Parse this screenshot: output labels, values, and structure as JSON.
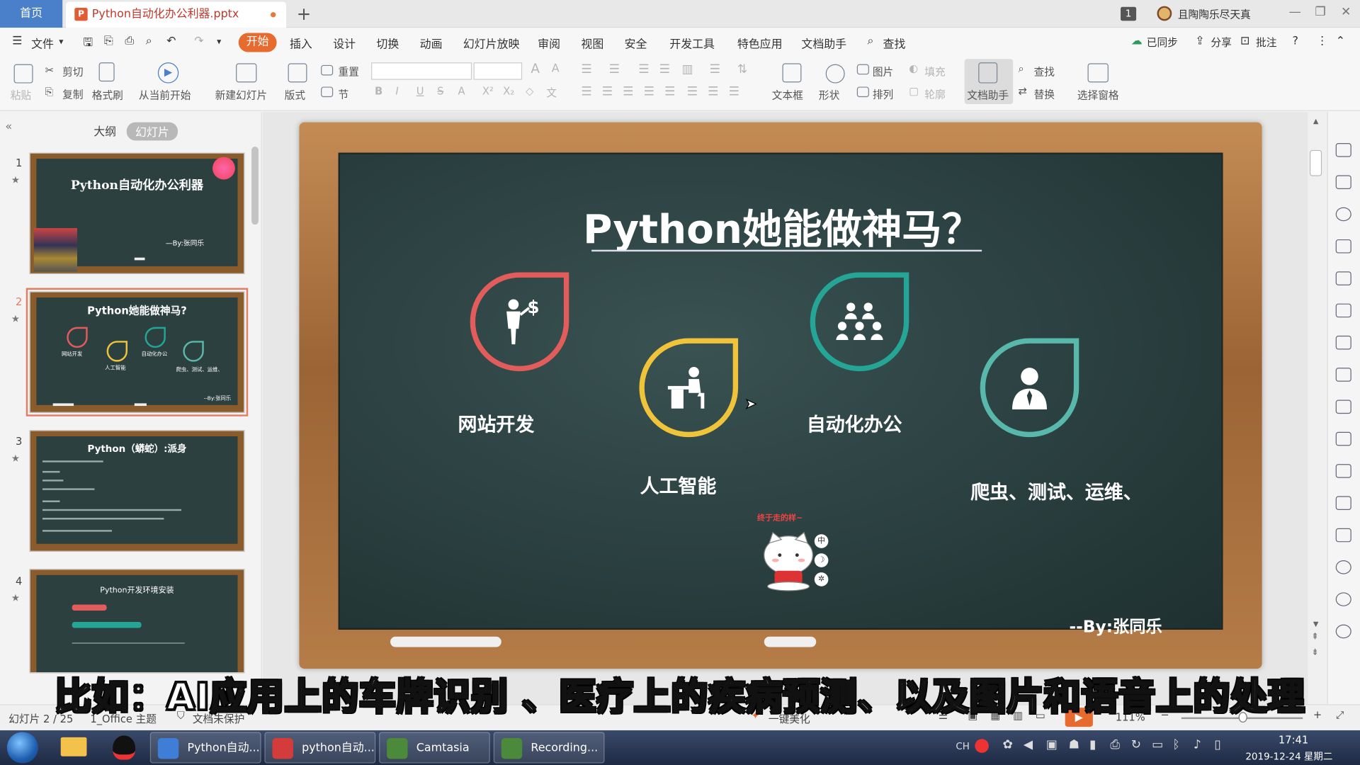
{
  "tabs": {
    "home": "首页",
    "doc": "Python自动化办公利器.pptx",
    "new_tab": "+"
  },
  "titlebar": {
    "badge": "1",
    "user": "且陶陶乐尽天真"
  },
  "menu": {
    "file": "文件",
    "items": [
      "插入",
      "设计",
      "切换",
      "动画",
      "幻灯片放映",
      "审阅",
      "视图",
      "安全",
      "开发工具",
      "特色应用",
      "文档助手"
    ],
    "active": "开始",
    "search": "查找",
    "sync": "已同步",
    "share": "分享",
    "review": "批注"
  },
  "ribbon": {
    "paste": "粘贴",
    "cut": "剪切",
    "copy": "复制",
    "format_painter": "格式刷",
    "from_current": "从当前开始",
    "new_slide": "新建幻灯片",
    "layout": "版式",
    "reset": "重置",
    "section": "节",
    "textbox": "文本框",
    "shape": "形状",
    "picture": "图片",
    "arrange": "排列",
    "fill": "填充",
    "outline": "轮廓",
    "doc_assistant": "文档助手",
    "find": "查找",
    "replace": "替换",
    "select_pane": "选择窗格"
  },
  "left_panel": {
    "tab_outline": "大纲",
    "tab_slides": "幻灯片"
  },
  "thumbnails": [
    {
      "num": "1",
      "title": "Python自动化办公利器",
      "by": "—By:张同乐"
    },
    {
      "num": "2",
      "title": "Python她能做神马?",
      "labels": [
        "网站开发",
        "人工智能",
        "自动化办公",
        "爬虫、测试、运维、"
      ],
      "by": "--By:张同乐"
    },
    {
      "num": "3",
      "title": "Python（蟒蛇）:派身"
    },
    {
      "num": "4",
      "title": "Python开发环境安装"
    }
  ],
  "slide": {
    "title": "Python她能做神马？",
    "items": [
      {
        "label": "网站开发",
        "icon": "presenter-dollar-icon",
        "color": "#e25c5c"
      },
      {
        "label": "人工智能",
        "icon": "desk-worker-icon",
        "color": "#f0c43a"
      },
      {
        "label": "自动化办公",
        "icon": "team-icon",
        "color": "#24a595"
      },
      {
        "label": "爬虫、测试、运维、",
        "icon": "person-icon",
        "color": "#58b8ab"
      }
    ],
    "byline": "--By:张同乐",
    "mascot_caption": "终于走的样~",
    "mascot_tools": [
      "中",
      "☽",
      "✲"
    ]
  },
  "subtitle": "比如：AI应用上的车牌识别 、医疗上的疾病预测、以及图片和语音上的处理",
  "statusbar": {
    "slide_info": "幻灯片 2 / 25",
    "theme": "1_Office 主题",
    "protection": "文档未保护",
    "beautify": "一键美化",
    "zoom": "111%"
  },
  "taskbar": {
    "apps": [
      {
        "label": "Python自动...",
        "color": "#3f7ed6"
      },
      {
        "label": "python自动...",
        "color": "#d43b3b"
      },
      {
        "label": "Camtasia St...",
        "color": "#4a8a3a"
      },
      {
        "label": "Recording...",
        "color": "#4a8a3a"
      }
    ],
    "ime": "CH",
    "time": "17:41",
    "date": "2019-12-24 星期二"
  }
}
